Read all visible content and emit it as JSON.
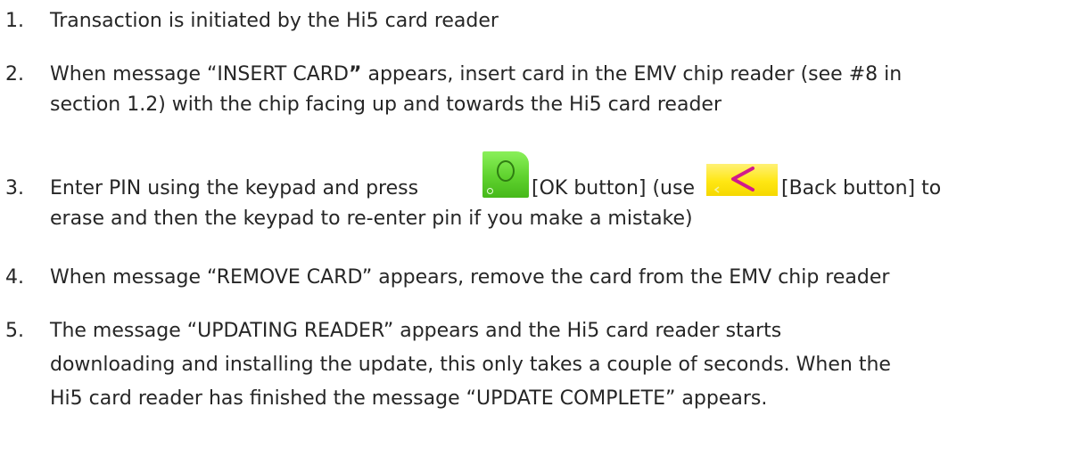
{
  "steps": [
    {
      "num": "1.",
      "text": "Transaction is initiated by the Hi5 card reader"
    },
    {
      "num": "2.",
      "line1_pre": "When message “INSERT CARD",
      "line1_bold": "”",
      "line1_post": " appears, insert card in the EMV chip reader (see #8 in",
      "line2": "section 1.2)  with the chip facing up and towards the Hi5 card reader"
    },
    {
      "num": "3.",
      "line1_pre": "Enter PIN using the keypad and press",
      "ok_label": "[OK button] (use",
      "back_label": "[Back button] to",
      "line2": "erase and then the keypad to re-enter pin if you make a mistake)",
      "ok_icon": "ok-button-circle-icon",
      "back_icon": "back-button-chevron-icon"
    },
    {
      "num": "4.",
      "text": "When message “REMOVE CARD” appears, remove the card from the EMV chip reader"
    },
    {
      "num": "5.",
      "line1": "The message “UPDATING READER” appears and the Hi5 card reader starts",
      "line2": "downloading and installing the update, this only takes a couple of seconds. When the",
      "line3": "Hi5 card reader has finished the message “UPDATE COMPLETE” appears."
    }
  ],
  "colors": {
    "text": "#262626",
    "ok_button": "#5fd22e",
    "back_button": "#ffe713",
    "back_chevron": "#d11a8c"
  }
}
